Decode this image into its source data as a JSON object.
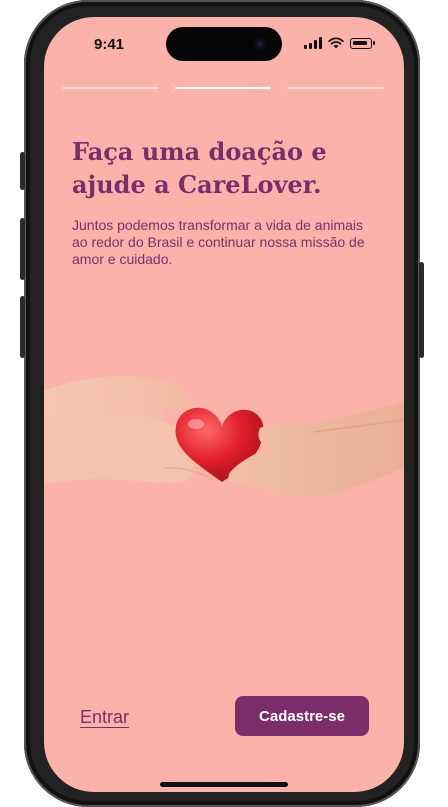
{
  "status_bar": {
    "time": "9:41"
  },
  "onboarding": {
    "steps_total": 3,
    "active_step": 2,
    "headline": "Faça uma doação e ajude a CareLover.",
    "description": "Juntos podemos transformar a vida de animais ao redor do Brasil e continuar nossa missão de amor e cuidado.",
    "illustration": "hands-holding-heart"
  },
  "actions": {
    "login_label": "Entrar",
    "signup_label": "Cadastre-se"
  },
  "colors": {
    "background": "#fbb2aa",
    "primary": "#7a2d68",
    "heart": "#e21f2b"
  }
}
